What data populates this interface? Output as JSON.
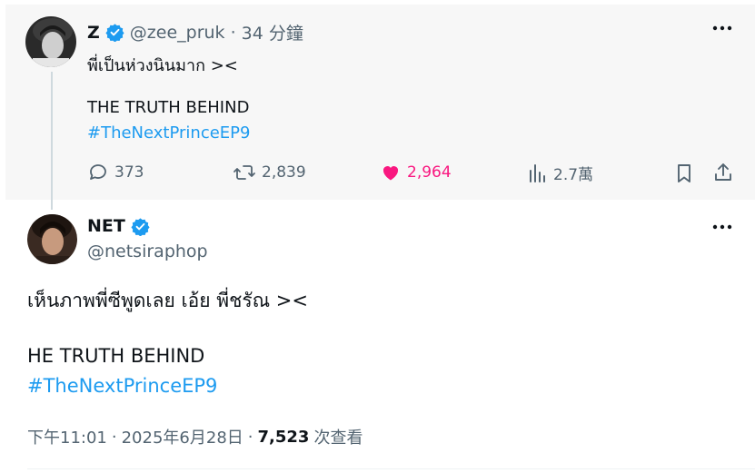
{
  "parent_tweet": {
    "display_name": "Z",
    "handle": "@zee_pruk",
    "separator": "·",
    "time_ago": "34 分鐘",
    "text_line1": "พี่เป็นห่วงนินมาก ><",
    "text_line2": "THE TRUTH BEHIND",
    "hashtag": "#TheNextPrinceEP9",
    "replies": "373",
    "reposts": "2,839",
    "likes": "2,964",
    "views": "2.7萬",
    "liked": true
  },
  "main_tweet": {
    "display_name": "NET",
    "handle": "@netsiraphop",
    "text_line1": "เห็นภาพพี่ซีพูดเลย เอ้ย พี่ชรัณ ><",
    "text_line2": "HE TRUTH BEHIND",
    "hashtag": "#TheNextPrinceEP9",
    "time": "下午11:01",
    "date": "2025年6月28日",
    "separator": "·",
    "views_count": "7,523",
    "views_label": "次查看"
  },
  "colors": {
    "accent": "#1d9bf0",
    "like": "#f91880",
    "muted": "#536471",
    "text": "#0f1419",
    "parent_bg": "#f7f7f7"
  },
  "icons": [
    "verified-badge-icon",
    "more-icon",
    "reply-icon",
    "repost-icon",
    "like-icon",
    "views-icon",
    "bookmark-icon",
    "share-icon"
  ]
}
